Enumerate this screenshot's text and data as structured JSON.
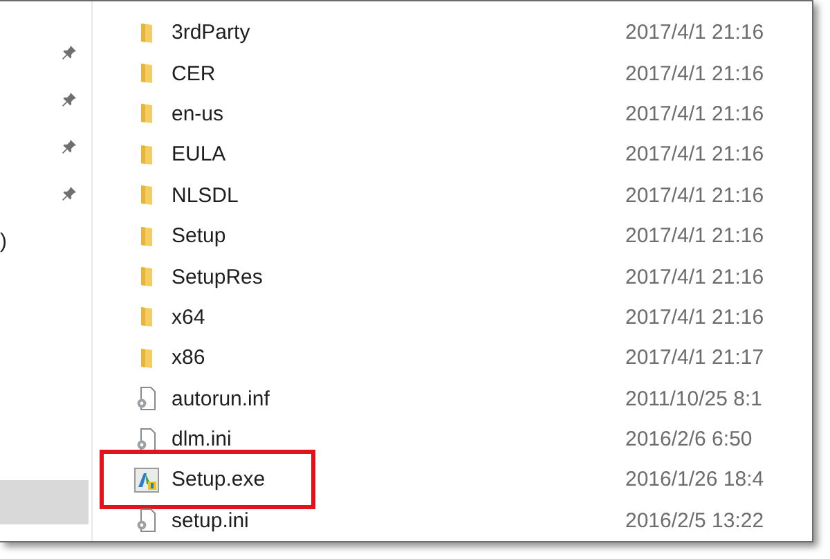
{
  "sidebar": {
    "items": [
      {
        "kind": "pin"
      },
      {
        "kind": "pin"
      },
      {
        "kind": "pin"
      },
      {
        "kind": "pin"
      },
      {
        "kind": "text",
        "text": ")"
      },
      {
        "kind": "blank",
        "selected": true
      }
    ]
  },
  "files": [
    {
      "name": "3rdParty",
      "kind": "folder",
      "date": "2017/4/1 21:16",
      "highlighted": false
    },
    {
      "name": "CER",
      "kind": "folder",
      "date": "2017/4/1 21:16",
      "highlighted": false
    },
    {
      "name": "en-us",
      "kind": "folder",
      "date": "2017/4/1 21:16",
      "highlighted": false
    },
    {
      "name": "EULA",
      "kind": "folder",
      "date": "2017/4/1 21:16",
      "highlighted": false
    },
    {
      "name": "NLSDL",
      "kind": "folder",
      "date": "2017/4/1 21:16",
      "highlighted": false
    },
    {
      "name": "Setup",
      "kind": "folder",
      "date": "2017/4/1 21:16",
      "highlighted": false
    },
    {
      "name": "SetupRes",
      "kind": "folder",
      "date": "2017/4/1 21:16",
      "highlighted": false
    },
    {
      "name": "x64",
      "kind": "folder",
      "date": "2017/4/1 21:16",
      "highlighted": false
    },
    {
      "name": "x86",
      "kind": "folder",
      "date": "2017/4/1 21:17",
      "highlighted": false
    },
    {
      "name": "autorun.inf",
      "kind": "config",
      "date": "2011/10/25 8:1",
      "highlighted": false
    },
    {
      "name": "dlm.ini",
      "kind": "config",
      "date": "2016/2/6 6:50",
      "highlighted": false
    },
    {
      "name": "Setup.exe",
      "kind": "exe",
      "date": "2016/1/26 18:4",
      "highlighted": true
    },
    {
      "name": "setup.ini",
      "kind": "config",
      "date": "2016/2/5 13:22",
      "highlighted": false
    }
  ]
}
